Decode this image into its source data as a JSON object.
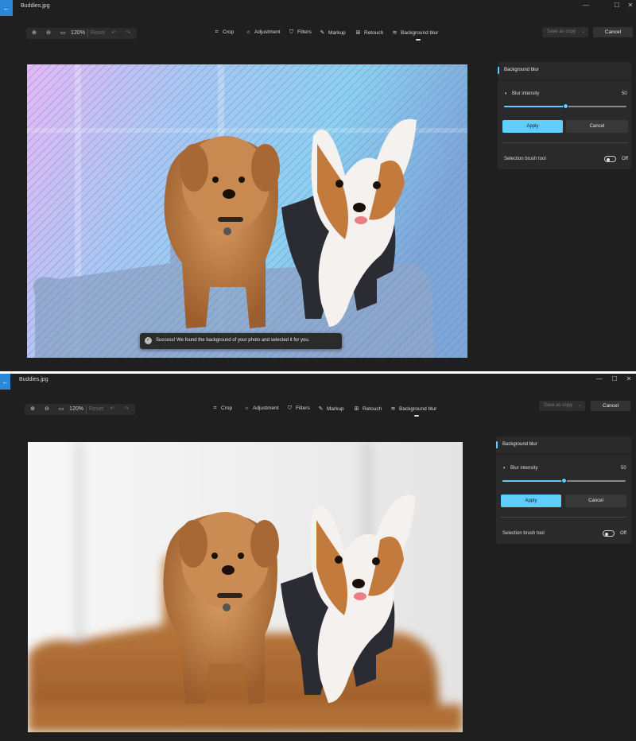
{
  "app": {
    "title": "Buddies.jpg",
    "back_icon": "←",
    "minimize_icon": "—",
    "maximize_icon": "☐",
    "close_icon": "✕"
  },
  "toolbar": {
    "zoom_in_icon": "⊕",
    "zoom_out_icon": "⊖",
    "fit_icon": "▭",
    "zoom_level": "120%",
    "reset_label": "Reset",
    "undo_icon": "↶",
    "redo_icon": "↷",
    "tools": [
      {
        "label": "Crop",
        "icon": "⌗"
      },
      {
        "label": "Adjustment",
        "icon": "☼"
      },
      {
        "label": "Filters",
        "icon": "⛉"
      },
      {
        "label": "Markup",
        "icon": "✎"
      },
      {
        "label": "Retouch",
        "icon": "⊞"
      },
      {
        "label": "Background blur",
        "icon": "≋"
      }
    ],
    "active_tool": "Background blur",
    "save_label": "Save as copy",
    "save_dropdown_icon": "⌄",
    "cancel_label": "Cancel"
  },
  "panel": {
    "title": "Background blur",
    "blur_label": "Blur intensity",
    "blur_icon": "◑",
    "blur_value": "50",
    "blur_fraction": 0.5,
    "apply_label": "Apply",
    "cancel_label": "Cancel",
    "brush_label": "Selection brush tool",
    "brush_state": "Off"
  },
  "toast": {
    "icon": "✓",
    "message": "Success! We found the background of your photo and selected it for you."
  },
  "colors": {
    "accent": "#60cdff",
    "window_bg": "#1f1f1f",
    "back_button": "#2b88d8",
    "panel_bg": "#2a2a2a"
  }
}
